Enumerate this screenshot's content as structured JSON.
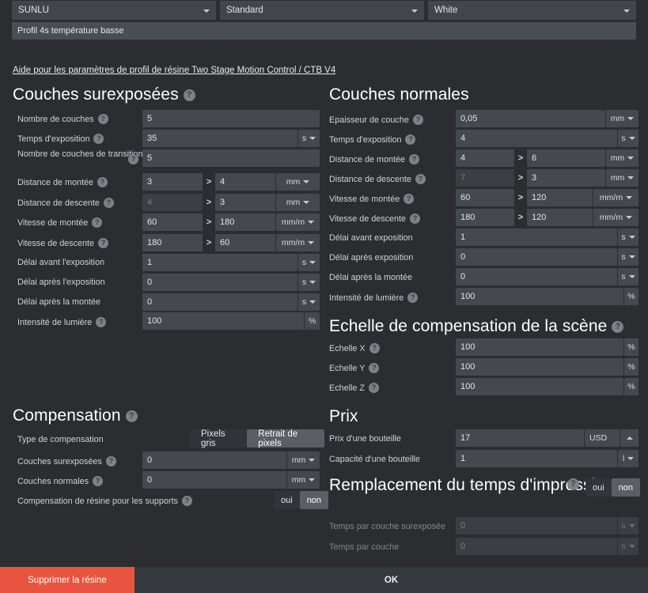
{
  "topbar": {
    "brand": "SUNLU",
    "type": "Standard",
    "color": "White",
    "profile_name": "Profil 4s température basse",
    "caret_icon": "chevron-down-icon"
  },
  "help_link": "Aide pour les paramètres de profil de résine Two Stage Motion Control / CTB V4",
  "sections": {
    "burn_in": {
      "title": "Couches surexposées",
      "rows": {
        "layer_count": {
          "label": "Nombre de couches",
          "value": "5"
        },
        "exposure_time": {
          "label": "Temps d'exposition",
          "value": "35",
          "unit": "s"
        },
        "transition_count": {
          "label": "Nombre de couches de transition",
          "value": "5"
        },
        "lift_distance": {
          "label": "Distance de montée",
          "value1": "3",
          "value2": "4",
          "unit": "mm"
        },
        "retract_distance": {
          "label": "Distance de descente",
          "value1": "4",
          "value2": "3",
          "unit": "mm"
        },
        "lift_speed": {
          "label": "Vitesse de montée",
          "value1": "60",
          "value2": "180",
          "unit": "mm/m"
        },
        "retract_speed": {
          "label": "Vitesse de descente",
          "value1": "180",
          "value2": "60",
          "unit": "mm/m"
        },
        "delay_before": {
          "label": "Délai avant l'exposition",
          "value": "1",
          "unit": "s"
        },
        "delay_after": {
          "label": "Délai après l'exposition",
          "value": "0",
          "unit": "s"
        },
        "delay_lift": {
          "label": "Délai après la montée",
          "value": "0",
          "unit": "s"
        },
        "light_intensity": {
          "label": "Intensité de lumière",
          "value": "100",
          "unit": "%"
        }
      }
    },
    "normal": {
      "title": "Couches normales",
      "rows": {
        "layer_thickness": {
          "label": "Epaisseur de couche",
          "value": "0,05",
          "unit": "mm"
        },
        "exposure_time": {
          "label": "Temps d'exposition",
          "value": "4",
          "unit": "s"
        },
        "lift_distance": {
          "label": "Distance de montée",
          "value1": "4",
          "value2": "6",
          "unit": "mm"
        },
        "retract_distance": {
          "label": "Distance de descente",
          "value1": "7",
          "value2": "3",
          "unit": "mm"
        },
        "lift_speed": {
          "label": "Vitesse de montée",
          "value1": "60",
          "value2": "120",
          "unit": "mm/m"
        },
        "retract_speed": {
          "label": "Vitesse de descente",
          "value1": "180",
          "value2": "120",
          "unit": "mm/m"
        },
        "delay_before": {
          "label": "Délai avant exposition",
          "value": "1",
          "unit": "s"
        },
        "delay_after": {
          "label": "Délai après exposition",
          "value": "0",
          "unit": "s"
        },
        "delay_lift": {
          "label": "Délai après la montée",
          "value": "0",
          "unit": "s"
        },
        "light_intensity": {
          "label": "Intensité de lumière",
          "value": "100",
          "unit": "%"
        }
      }
    },
    "scene_scale": {
      "title": "Echelle de compensation de la scène",
      "rows": {
        "x": {
          "label": "Echelle X",
          "value": "100",
          "unit": "%"
        },
        "y": {
          "label": "Echelle Y",
          "value": "100",
          "unit": "%"
        },
        "z": {
          "label": "Echelle Z",
          "value": "100",
          "unit": "%"
        }
      }
    },
    "compensation": {
      "title": "Compensation",
      "type_label": "Type de compensation",
      "type_option_1": "Pixels gris",
      "type_option_2": "Retrait de pixels",
      "rows": {
        "burn_in": {
          "label": "Couches surexposées",
          "value": "0",
          "unit": "mm"
        },
        "normal": {
          "label": "Couches normales",
          "value": "0",
          "unit": "mm"
        }
      },
      "supports_label": "Compensation de résine pour les supports",
      "supports_yes": "oui",
      "supports_no": "non"
    },
    "price": {
      "title": "Prix",
      "rows": {
        "bottle_price": {
          "label": "Prix d'une bouteille",
          "value": "17",
          "unit": "USD"
        },
        "bottle_capacity": {
          "label": "Capacité d'une bouteille",
          "value": "1",
          "unit": "l"
        }
      }
    },
    "print_time_override": {
      "title": "Remplacement du temps d'impression",
      "yes": "oui",
      "no": "non",
      "rows": {
        "burn_in": {
          "label": "Temps par couche surexposée",
          "value": "0",
          "unit": "s"
        },
        "normal": {
          "label": "Temps par couche",
          "value": "0",
          "unit": "s"
        }
      }
    }
  },
  "footer": {
    "delete_label": "Supprimer la résine",
    "ok_label": "OK"
  },
  "colors": {
    "background": "#2b2d30",
    "field": "#45494f",
    "field_disabled": "#3b3e43",
    "accent_delete": "#e8543f",
    "toggle_on": "#5a5f66"
  },
  "help_icon": "?"
}
